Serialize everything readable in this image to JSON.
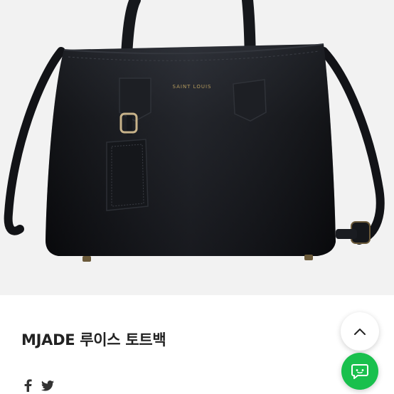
{
  "product": {
    "title": "MJADE 루이스 토트백",
    "image_alt": "black leather tote bag",
    "brand_stamp": "SAINT LOUIS"
  },
  "share": {
    "facebook_icon": "facebook-icon",
    "twitter_icon": "twitter-icon"
  },
  "floating": {
    "scroll_top_icon": "chevron-up-icon",
    "chat_icon": "chat-icon",
    "chat_color": "#19c04d"
  }
}
